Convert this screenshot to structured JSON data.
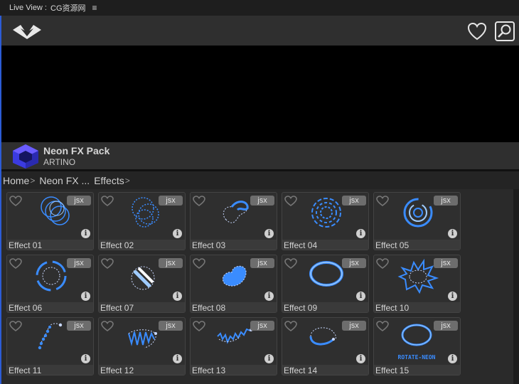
{
  "panel": {
    "title": "Live View :",
    "source": "CG资源网",
    "menu_glyph": "≡"
  },
  "header": {
    "logo_icon": "eye-logo-icon",
    "favorites_icon": "heart-icon",
    "search_icon": "search-icon"
  },
  "product": {
    "name": "Neon FX Pack",
    "author": "ARTINO",
    "icon": "cube-logo-icon"
  },
  "breadcrumb": {
    "items": [
      {
        "label": "Home"
      },
      {
        "label": "Neon FX ..."
      },
      {
        "label": "Effects"
      }
    ],
    "separator": ">"
  },
  "tiles": [
    {
      "label": "Effect 01",
      "badge": "jsx",
      "info": "i",
      "icon": "neon-rings-icon"
    },
    {
      "label": "Effect 02",
      "badge": "jsx",
      "info": "i",
      "icon": "neon-dotted-rings-icon"
    },
    {
      "label": "Effect 03",
      "badge": "jsx",
      "info": "i",
      "icon": "neon-blob-icon"
    },
    {
      "label": "Effect 04",
      "badge": "jsx",
      "info": "i",
      "icon": "neon-dashed-circles-icon"
    },
    {
      "label": "Effect 05",
      "badge": "jsx",
      "info": "i",
      "icon": "neon-spiral-icon"
    },
    {
      "label": "Effect 06",
      "badge": "jsx",
      "info": "i",
      "icon": "neon-arc-ring-icon"
    },
    {
      "label": "Effect 07",
      "badge": "jsx",
      "info": "i",
      "icon": "neon-striped-shape-icon"
    },
    {
      "label": "Effect 08",
      "badge": "jsx",
      "info": "i",
      "icon": "neon-dotted-fill-icon"
    },
    {
      "label": "Effect 09",
      "badge": "jsx",
      "info": "i",
      "icon": "neon-glow-ring-icon"
    },
    {
      "label": "Effect 10",
      "badge": "jsx",
      "info": "i",
      "icon": "neon-burst-icon"
    },
    {
      "label": "Effect 11",
      "badge": "jsx",
      "info": "i",
      "icon": "neon-dot-path-icon"
    },
    {
      "label": "Effect 12",
      "badge": "jsx",
      "info": "i",
      "icon": "neon-zigzag-fill-icon"
    },
    {
      "label": "Effect 13",
      "badge": "jsx",
      "info": "i",
      "icon": "neon-jagged-line-icon"
    },
    {
      "label": "Effect 14",
      "badge": "jsx",
      "info": "i",
      "icon": "neon-curve-line-icon"
    },
    {
      "label": "Effect 15",
      "badge": "jsx",
      "info": "i",
      "icon": "neon-rotate-icon",
      "caption": "ROTATE-NEON"
    }
  ],
  "colors": {
    "neon": "#3a8cff",
    "neon_light": "#9ecbff",
    "accent_border": "#2c5cd6",
    "badge": "#6d6d6d"
  }
}
